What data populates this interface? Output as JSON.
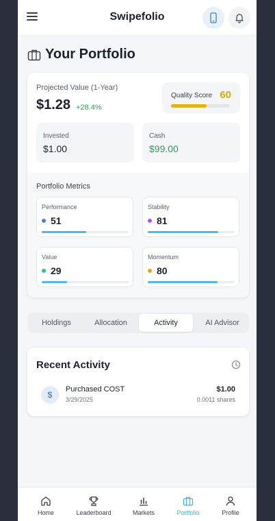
{
  "header": {
    "title": "Swipefolio",
    "menu_icon": "hamburger-menu-icon",
    "phone_icon": "smartphone-icon",
    "bell_icon": "bell-icon"
  },
  "page": {
    "title": "Your Portfolio",
    "icon": "briefcase-icon"
  },
  "summary": {
    "projected_label": "Projected Value (1-Year)",
    "projected_value": "$1.28",
    "projected_change": "+28.4%",
    "quality_label": "Quality Score",
    "quality_value": "60",
    "quality_fraction": 0.6,
    "invested_label": "Invested",
    "invested_value": "$1.00",
    "cash_label": "Cash",
    "cash_value": "$99.00"
  },
  "metrics": {
    "title": "Portfolio Metrics",
    "items": [
      {
        "label": "Performance",
        "value": "51",
        "level": 0.51,
        "dot_color": "#4a7df0"
      },
      {
        "label": "Stability",
        "value": "81",
        "level": 0.81,
        "dot_color": "#a855f7"
      },
      {
        "label": "Value",
        "value": "29",
        "level": 0.29,
        "dot_color": "#3fbf7f"
      },
      {
        "label": "Momentum",
        "value": "80",
        "level": 0.8,
        "dot_color": "#e6a417"
      }
    ]
  },
  "tabs": {
    "active": 2,
    "items": [
      {
        "label": "Holdings"
      },
      {
        "label": "Allocation"
      },
      {
        "label": "Activity"
      },
      {
        "label": "AI Advisor"
      }
    ]
  },
  "activity": {
    "title": "Recent Activity",
    "history_icon": "clock-icon",
    "items": [
      {
        "icon": "dollar-icon",
        "symbol": "$",
        "name": "Purchased COST",
        "date": "3/29/2025",
        "amount": "$1.00",
        "shares": "0.0011 shares"
      }
    ]
  },
  "nav": {
    "active": 3,
    "items": [
      {
        "label": "Home",
        "icon": "home-icon"
      },
      {
        "label": "Leaderboard",
        "icon": "trophy-icon"
      },
      {
        "label": "Markets",
        "icon": "bar-chart-icon"
      },
      {
        "label": "Portfolio",
        "icon": "briefcase-icon"
      },
      {
        "label": "Profile",
        "icon": "user-icon"
      }
    ]
  },
  "colors": {
    "accent": "#3bb3e6",
    "positive": "#2f9e5e",
    "quality": "#e3b40b",
    "background": "#2a2f3e"
  }
}
